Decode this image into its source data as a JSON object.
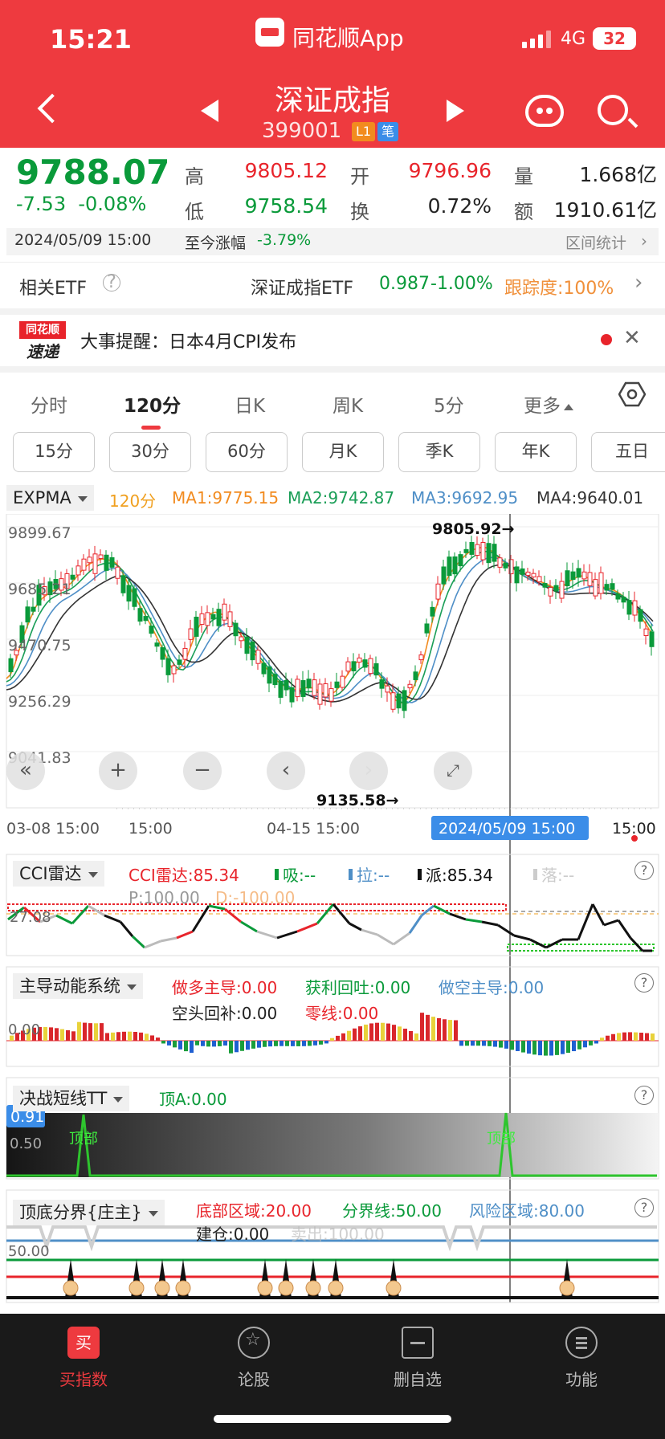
{
  "status": {
    "time": "15:21",
    "network": "4G",
    "battery": "32"
  },
  "header": {
    "app_name": "同花顺App",
    "stock_name": "深证成指",
    "stock_code": "399001",
    "tag_l1": "L1",
    "tag_bi": "笔"
  },
  "quote": {
    "price": "9788.07",
    "change": "-7.53",
    "change_pct": "-0.08%",
    "high_label": "高",
    "high": "9805.12",
    "low_label": "低",
    "low": "9758.54",
    "open_label": "开",
    "open": "9796.96",
    "turnover_label": "换",
    "turnover": "0.72%",
    "volume_label": "量",
    "volume": "1.668亿",
    "amount_label": "额",
    "amount": "1910.61亿",
    "datetime": "2024/05/09 15:00",
    "ytd_label": "至今涨幅",
    "ytd": "-3.79%",
    "interval_stat": "区间统计"
  },
  "etf": {
    "label": "相关ETF",
    "name": "深证成指ETF",
    "price": "0.987",
    "pct": "-1.00%",
    "tracking": "跟踪度:100%"
  },
  "news": {
    "logo_top": "同花顺",
    "logo_bottom": "速递",
    "text": "大事提醒：日本4月CPI发布"
  },
  "tabs": [
    "分时",
    "120分",
    "日K",
    "周K",
    "5分",
    "更多"
  ],
  "chips": [
    "15分",
    "30分",
    "60分",
    "月K",
    "季K",
    "年K",
    "五日"
  ],
  "main_chart": {
    "indicator": "EXPMA",
    "period": "120分",
    "ma1": "MA1:9775.15",
    "ma2": "MA2:9742.87",
    "ma3": "MA3:9692.95",
    "ma4": "MA4:9640.01",
    "y_labels": [
      "9899.67",
      "9685.21",
      "9470.75",
      "9256.29",
      "9041.83"
    ],
    "high_mark": "9805.92→",
    "low_mark": "9135.58→",
    "x_labels": [
      "03-08 15:00",
      "15:00",
      "04-15 15:00",
      "15:00"
    ],
    "cursor_date": "2024/05/09 15:00"
  },
  "cci": {
    "name": "CCI雷达",
    "value": "CCI雷达:85.34",
    "xi": "吸:--",
    "la": "拉:--",
    "pai": "派:85.34",
    "luo": "落:--",
    "p": "P:100.00",
    "d": "D:-100.00",
    "level": "27.08"
  },
  "zdnl": {
    "name": "主导动能系统",
    "zdduo": "做多主导:0.00",
    "hltu": "获利回吐:0.00",
    "zkzd": "做空主导:0.00",
    "ktbh": "空头回补:0.00",
    "line0": "零线:0.00",
    "level": "0.00"
  },
  "tt": {
    "name": "决战短线TT",
    "topa": "顶A:0.00",
    "badge": "0.91",
    "level": "0.50",
    "top_label": "顶部"
  },
  "ddfj": {
    "name": "顶底分界{庄主}",
    "bottom": "底部区域:20.00",
    "mid": "分界线:50.00",
    "risk": "风险区域:80.00",
    "jc": "建仓:0.00",
    "mc": "卖出:100.00",
    "level": "50.00"
  },
  "bottom_nav": [
    {
      "label": "买指数",
      "icon": "买"
    },
    {
      "label": "论股"
    },
    {
      "label": "删自选"
    },
    {
      "label": "功能"
    }
  ],
  "colors": {
    "up": "#e8242b",
    "down": "#0a9a3a",
    "header": "#ee3a3f",
    "ma1": "#f28b1f",
    "ma2": "#1a9e57",
    "ma3": "#4f8fc7",
    "ma4": "#333333"
  }
}
